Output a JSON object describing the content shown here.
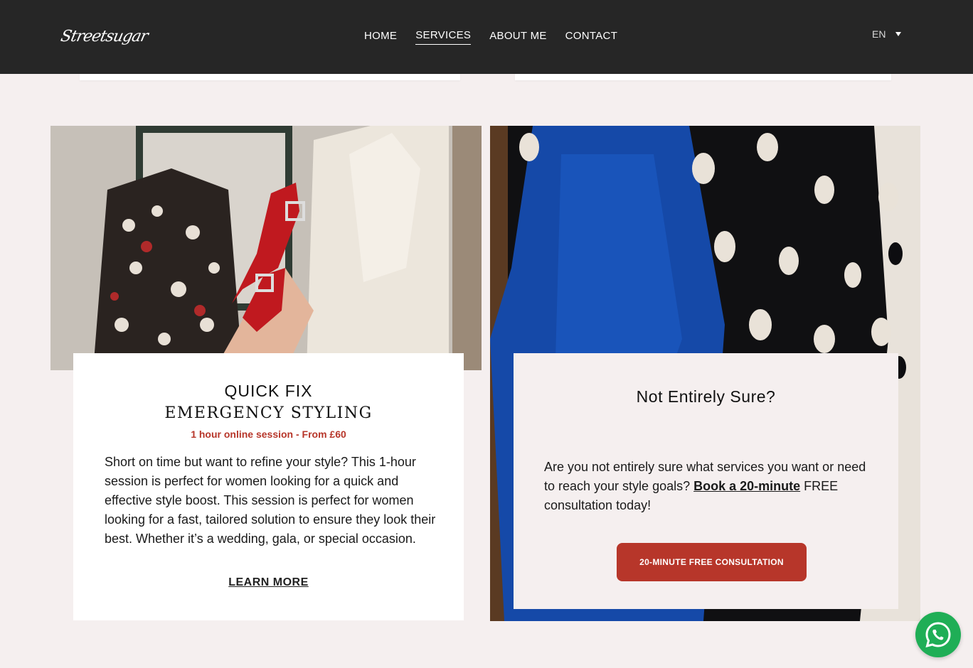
{
  "header": {
    "logo_text": "Streetsugar",
    "nav": [
      {
        "label": "HOME",
        "active": false
      },
      {
        "label": "SERVICES",
        "active": true
      },
      {
        "label": "ABOUT ME",
        "active": false
      },
      {
        "label": "CONTACT",
        "active": false
      }
    ],
    "language": "EN"
  },
  "quick_fix": {
    "title_line1": "QUICK FIX",
    "title_line2": "EMERGENCY STYLING",
    "subtitle": "1 hour online session - From £60",
    "description": "Short on time but want to refine your style? This 1-hour session is perfect for women looking for a quick and effective style boost. This session is perfect for women looking for a fast, tailored solution to ensure they look their best. Whether it’s a wedding, gala, or special occasion.",
    "learn_more": "LEARN MORE"
  },
  "not_sure": {
    "title": "Not Entirely Sure?",
    "text_before": "Are you not entirely sure what services you want or need to reach your style goals? ",
    "link_text": "Book a 20-minute",
    "text_after": " FREE consultation today!",
    "cta_label": "20-MINUTE FREE CONSULTATION"
  },
  "colors": {
    "accent": "#b7362a",
    "header_bg": "#262626",
    "page_bg": "#f5efef",
    "whatsapp": "#1fae56"
  },
  "icons": {
    "whatsapp": "whatsapp-icon",
    "language_caret": "caret-down-icon"
  }
}
